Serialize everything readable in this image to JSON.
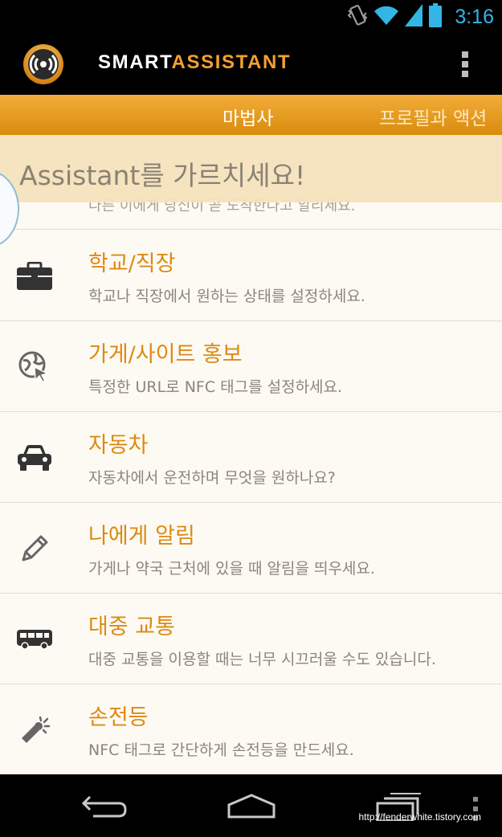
{
  "status_bar": {
    "time": "3:16",
    "icons": [
      "vibrate-icon",
      "wifi-icon",
      "signal-icon",
      "battery-icon"
    ]
  },
  "app": {
    "title_white": "SMART",
    "title_accent": "ASSISTANT",
    "logo_icon": "nfc-logo-icon",
    "menu_icon": "overflow-menu-icon"
  },
  "tabs": [
    {
      "label": "마법사",
      "active": true
    },
    {
      "label": "프로필과 액션",
      "active": false
    }
  ],
  "banner": {
    "text": "Assistant를 가르치세요!"
  },
  "partial_item": {
    "desc": "다른 이에게 당신이 곧 도착한다고 알리세요."
  },
  "list_items": [
    {
      "title": "학교/직장",
      "desc": "학교나 직장에서 원하는 상태를 설정하세요.",
      "icon": "briefcase-icon"
    },
    {
      "title": "가게/사이트 홍보",
      "desc": "특정한 URL로 NFC 태그를 설정하세요.",
      "icon": "globe-cursor-icon"
    },
    {
      "title": "자동차",
      "desc": "자동차에서 운전하며 무엇을 원하나요?",
      "icon": "car-icon"
    },
    {
      "title": "나에게 알림",
      "desc": "가게나 약국 근처에 있을 때 알림을 띄우세요.",
      "icon": "pencil-icon"
    },
    {
      "title": "대중 교통",
      "desc": "대중 교통을 이용할 때는 너무 시끄러울 수도 있습니다.",
      "icon": "bus-icon"
    },
    {
      "title": "손전등",
      "desc": "NFC 태그로 간단하게 손전등을 만드세요.",
      "icon": "flashlight-icon"
    }
  ],
  "nav_bar": {
    "buttons": [
      "back-icon",
      "home-icon",
      "recent-apps-icon",
      "menu-icon"
    ],
    "watermark": "http://fenderwhite.tistory.com"
  },
  "colors": {
    "accent": "#f2a130",
    "item_title": "#dc8a13",
    "tab_bar": "#e59b1f",
    "clock": "#33b5e5",
    "banner": "#f5e1ba",
    "content_bg": "#fdfaf3"
  }
}
